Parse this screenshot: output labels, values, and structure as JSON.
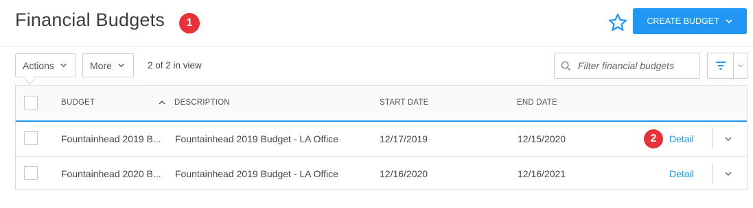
{
  "header": {
    "title": "Financial Budgets",
    "title_badge": "1",
    "favorite_icon": "star-icon",
    "create_label": "CREATE BUDGET"
  },
  "toolbar": {
    "actions_label": "Actions",
    "more_label": "More",
    "view_count": "2 of 2 in view",
    "filter_placeholder": "Filter financial budgets"
  },
  "table": {
    "columns": [
      "BUDGET",
      "DESCRIPTION",
      "START DATE",
      "END DATE"
    ],
    "sort_icon": "chevron-up-icon",
    "rows": [
      {
        "budget": "Fountainhead 2019 B...",
        "description": "Fountainhead 2019 Budget - LA Office",
        "start_date": "12/17/2019",
        "end_date": "12/15/2020",
        "action_label": "Detail",
        "badge": "2"
      },
      {
        "budget": "Fountainhead 2020 B...",
        "description": "Fountainhead 2019 Budget - LA Office",
        "start_date": "12/16/2020",
        "end_date": "12/16/2021",
        "action_label": "Detail"
      }
    ]
  },
  "colors": {
    "accent": "#2196f3",
    "badge": "#e8323a",
    "border": "#d8d8d8"
  }
}
